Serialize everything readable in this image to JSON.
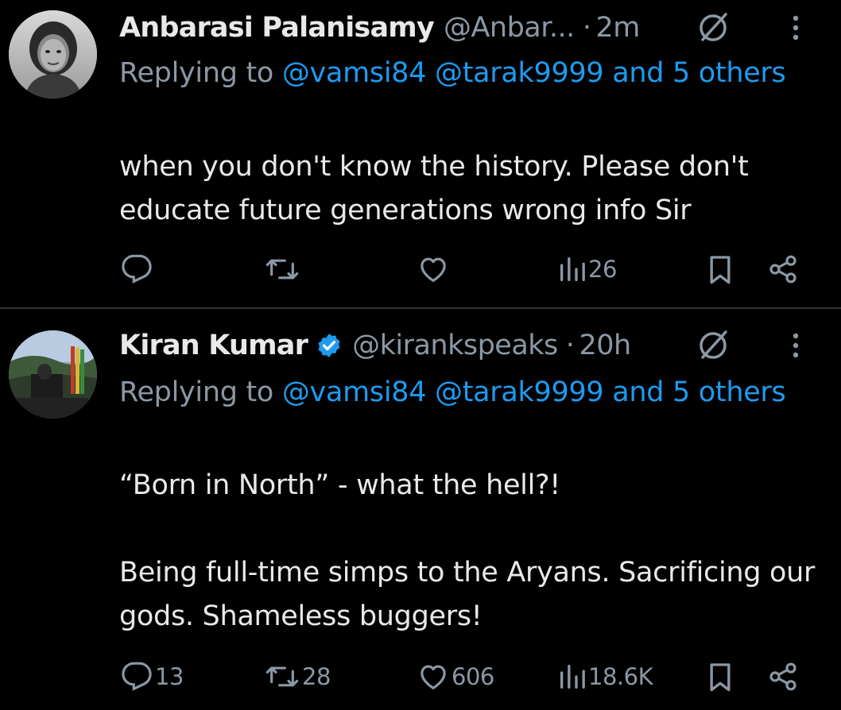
{
  "colors": {
    "background": "#000000",
    "text_primary": "#e7e9ea",
    "text_secondary": "#8b98a5",
    "link": "#1d9bf0",
    "verified": "#1d9bf0",
    "divider": "#2f3336"
  },
  "tweets": [
    {
      "display_name": "Anbarasi Palanisamy",
      "handle": "@Anbar...",
      "separator": "·",
      "time": "2m",
      "verified": false,
      "replying_prefix": "Replying to",
      "replying_mentions": "@vamsi84 @tarak9999 and 5 others",
      "text": "when you don't know the history. Please don't educate future generations wrong info Sir",
      "actions": {
        "replies": "",
        "retweets": "",
        "likes": "",
        "views": "26"
      },
      "icons": [
        "grok-icon",
        "more-icon",
        "reply-icon",
        "retweet-icon",
        "like-icon",
        "views-icon",
        "bookmark-icon",
        "share-icon"
      ]
    },
    {
      "display_name": "Kiran Kumar",
      "handle": "@kirankspeaks",
      "separator": "·",
      "time": "20h",
      "verified": true,
      "replying_prefix": "Replying to",
      "replying_mentions": "@vamsi84 @tarak9999 and 5 others",
      "text": "“Born in North” - what the hell?!\n\nBeing full-time simps to the Aryans. Sacrificing our gods. Shameless buggers!",
      "actions": {
        "replies": "13",
        "retweets": "28",
        "likes": "606",
        "views": "18.6K"
      },
      "icons": [
        "verified-badge-icon",
        "grok-icon",
        "more-icon",
        "reply-icon",
        "retweet-icon",
        "like-icon",
        "views-icon",
        "bookmark-icon",
        "share-icon"
      ]
    }
  ]
}
